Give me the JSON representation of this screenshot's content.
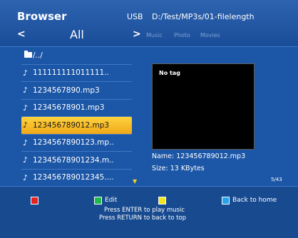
{
  "header": {
    "title": "Browser",
    "device": "USB",
    "path": "D:/Test/MP3s/01-filelength",
    "nav_left": "<",
    "nav_right": ">",
    "current_category": "All",
    "categories": [
      "Music",
      "Photo",
      "Movies"
    ]
  },
  "file_list": {
    "items": [
      {
        "label": "/../",
        "icon": "folder-icon",
        "selected": false
      },
      {
        "label": "111111111011111..",
        "icon": "music-note-icon",
        "selected": false
      },
      {
        "label": "1234567890.mp3",
        "icon": "music-note-icon",
        "selected": false
      },
      {
        "label": "12345678901.mp3",
        "icon": "music-note-icon",
        "selected": false
      },
      {
        "label": "123456789012.mp3",
        "icon": "music-note-icon",
        "selected": true
      },
      {
        "label": "1234567890123.mp..",
        "icon": "music-note-icon",
        "selected": false
      },
      {
        "label": "12345678901234.m..",
        "icon": "music-note-icon",
        "selected": false
      },
      {
        "label": "123456789012345....",
        "icon": "music-note-icon",
        "selected": false
      }
    ],
    "scroll_indicator": "▼"
  },
  "preview": {
    "tag_text": "No tag",
    "name_line": "Name: 123456789012.mp3",
    "size_line": "Size: 13 KBytes",
    "counter": "5/43"
  },
  "footer": {
    "buttons": [
      {
        "color": "#e52222",
        "label": ""
      },
      {
        "color": "#1fb84a",
        "label": "Edit"
      },
      {
        "color": "#f2e51c",
        "label": ""
      },
      {
        "color": "#26a3e8",
        "label": "Back to home"
      }
    ],
    "hint_1": "Press ENTER to play music",
    "hint_2": "Press RETURN to back to top"
  },
  "colors": {
    "background": "#1c56a6",
    "highlight": "#f5c02c",
    "preview_bg": "#000000"
  }
}
